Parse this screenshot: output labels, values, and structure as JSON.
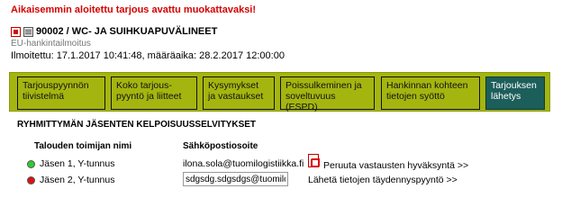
{
  "notice": "Aikaisemmin aloitettu tarjous avattu muokattavaksi!",
  "header": {
    "title": "90002 / WC- JA SUIHKUAPUVÄLINEET",
    "subtype": "EU-hankintailmoitus",
    "dates": "Ilmoitettu: 17.1.2017 10:41:48, määräaika: 28.2.2017 12:00:00"
  },
  "tabs": [
    {
      "line1": "Tarjouspyynnön",
      "line2": "tiivistelmä"
    },
    {
      "line1": "Koko tarjous-",
      "line2": "pyyntö ja liitteet"
    },
    {
      "line1": "Kysymykset",
      "line2": "ja vastaukset"
    },
    {
      "line1": "Poissulkeminen ja",
      "line2": "soveltuvuus (ESPD)"
    },
    {
      "line1": "Hankinnan kohteen",
      "line2": "tietojen syöttö"
    },
    {
      "line1": "Tarjouksen",
      "line2": "lähetys"
    }
  ],
  "section_title": "RYHMITTYMÄN JÄSENTEN KELPOISUUSSELVITYKSET",
  "columns": {
    "name": "Talouden toimijan nimi",
    "email": "Sähköpostiosoite"
  },
  "members": [
    {
      "name": "Jäsen 1, Y-tunnus",
      "status_color": "#2ecc2e",
      "email": "ilona.sola@tuomilogistiikka.fi",
      "action": "Peruuta vastausten hyväksyntä >>"
    },
    {
      "name": "Jäsen 2, Y-tunnus",
      "status_color": "#dd1111",
      "email_value": "sdgsdg.sdgsdgs@tuomilc",
      "action": "Lähetä tietojen täydennyspyyntö >>"
    }
  ],
  "colors": {
    "tab_bar": "#a5b50f",
    "active_tab": "#1c5e5a",
    "notice": "#d40000"
  }
}
